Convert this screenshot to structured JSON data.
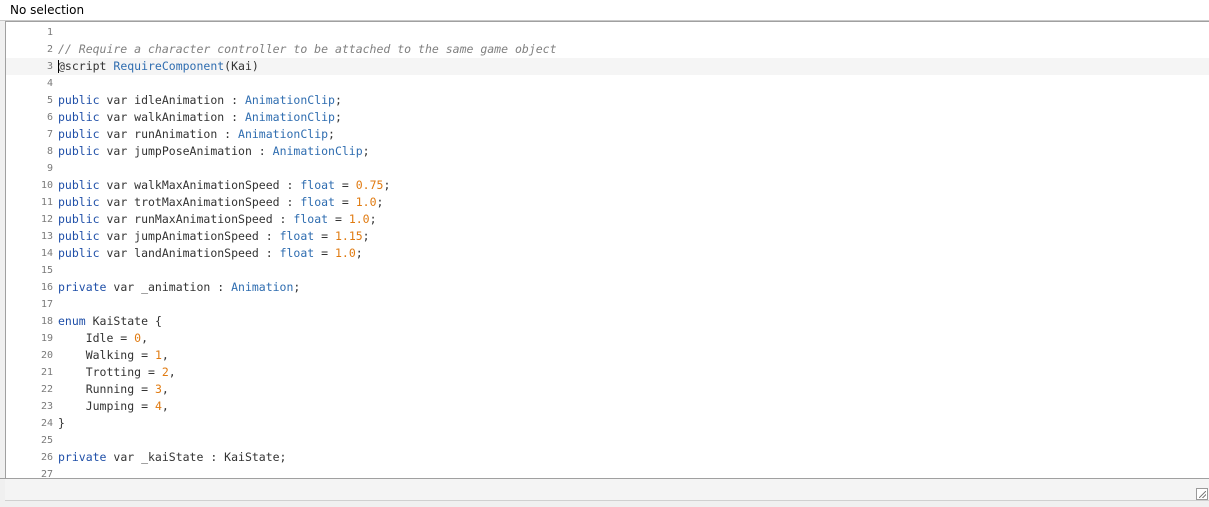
{
  "title_bar": {
    "text": "No selection"
  },
  "editor": {
    "lines": [
      {
        "num": "1",
        "tokens": []
      },
      {
        "num": "2",
        "tokens": [
          [
            "cm",
            "// Require a character controller to be attached to the same game object"
          ]
        ]
      },
      {
        "num": "3",
        "current": true,
        "tokens": [
          [
            "",
            "@script "
          ],
          [
            "ty",
            "RequireComponent"
          ],
          [
            "",
            "(Kai)"
          ]
        ]
      },
      {
        "num": "4",
        "tokens": []
      },
      {
        "num": "5",
        "tokens": [
          [
            "kw",
            "public"
          ],
          [
            "",
            " var idleAnimation : "
          ],
          [
            "ty",
            "AnimationClip"
          ],
          [
            "",
            ";"
          ]
        ]
      },
      {
        "num": "6",
        "tokens": [
          [
            "kw",
            "public"
          ],
          [
            "",
            " var walkAnimation : "
          ],
          [
            "ty",
            "AnimationClip"
          ],
          [
            "",
            ";"
          ]
        ]
      },
      {
        "num": "7",
        "tokens": [
          [
            "kw",
            "public"
          ],
          [
            "",
            " var runAnimation : "
          ],
          [
            "ty",
            "AnimationClip"
          ],
          [
            "",
            ";"
          ]
        ]
      },
      {
        "num": "8",
        "tokens": [
          [
            "kw",
            "public"
          ],
          [
            "",
            " var jumpPoseAnimation : "
          ],
          [
            "ty",
            "AnimationClip"
          ],
          [
            "",
            ";"
          ]
        ]
      },
      {
        "num": "9",
        "tokens": []
      },
      {
        "num": "10",
        "tokens": [
          [
            "kw",
            "public"
          ],
          [
            "",
            " var walkMaxAnimationSpeed : "
          ],
          [
            "ty",
            "float"
          ],
          [
            "",
            " = "
          ],
          [
            "num",
            "0.75"
          ],
          [
            "",
            ";"
          ]
        ]
      },
      {
        "num": "11",
        "tokens": [
          [
            "kw",
            "public"
          ],
          [
            "",
            " var trotMaxAnimationSpeed : "
          ],
          [
            "ty",
            "float"
          ],
          [
            "",
            " = "
          ],
          [
            "num",
            "1.0"
          ],
          [
            "",
            ";"
          ]
        ]
      },
      {
        "num": "12",
        "tokens": [
          [
            "kw",
            "public"
          ],
          [
            "",
            " var runMaxAnimationSpeed : "
          ],
          [
            "ty",
            "float"
          ],
          [
            "",
            " = "
          ],
          [
            "num",
            "1.0"
          ],
          [
            "",
            ";"
          ]
        ]
      },
      {
        "num": "13",
        "tokens": [
          [
            "kw",
            "public"
          ],
          [
            "",
            " var jumpAnimationSpeed : "
          ],
          [
            "ty",
            "float"
          ],
          [
            "",
            " = "
          ],
          [
            "num",
            "1.15"
          ],
          [
            "",
            ";"
          ]
        ]
      },
      {
        "num": "14",
        "tokens": [
          [
            "kw",
            "public"
          ],
          [
            "",
            " var landAnimationSpeed : "
          ],
          [
            "ty",
            "float"
          ],
          [
            "",
            " = "
          ],
          [
            "num",
            "1.0"
          ],
          [
            "",
            ";"
          ]
        ]
      },
      {
        "num": "15",
        "tokens": []
      },
      {
        "num": "16",
        "tokens": [
          [
            "kw",
            "private"
          ],
          [
            "",
            " var _animation : "
          ],
          [
            "ty",
            "Animation"
          ],
          [
            "",
            ";"
          ]
        ]
      },
      {
        "num": "17",
        "tokens": []
      },
      {
        "num": "18",
        "tokens": [
          [
            "kw",
            "enum"
          ],
          [
            "",
            " KaiState {"
          ]
        ]
      },
      {
        "num": "19",
        "tokens": [
          [
            "",
            "    Idle = "
          ],
          [
            "num",
            "0"
          ],
          [
            "",
            ","
          ]
        ]
      },
      {
        "num": "20",
        "tokens": [
          [
            "",
            "    Walking = "
          ],
          [
            "num",
            "1"
          ],
          [
            "",
            ","
          ]
        ]
      },
      {
        "num": "21",
        "tokens": [
          [
            "",
            "    Trotting = "
          ],
          [
            "num",
            "2"
          ],
          [
            "",
            ","
          ]
        ]
      },
      {
        "num": "22",
        "tokens": [
          [
            "",
            "    Running = "
          ],
          [
            "num",
            "3"
          ],
          [
            "",
            ","
          ]
        ]
      },
      {
        "num": "23",
        "tokens": [
          [
            "",
            "    Jumping = "
          ],
          [
            "num",
            "4"
          ],
          [
            "",
            ","
          ]
        ]
      },
      {
        "num": "24",
        "tokens": [
          [
            "",
            "}"
          ]
        ]
      },
      {
        "num": "25",
        "tokens": []
      },
      {
        "num": "26",
        "tokens": [
          [
            "kw",
            "private"
          ],
          [
            "",
            " var _kaiState : KaiState;"
          ]
        ]
      },
      {
        "num": "27",
        "tokens": []
      }
    ]
  },
  "icons": {
    "resize_grip": "resize-grip-icon"
  }
}
